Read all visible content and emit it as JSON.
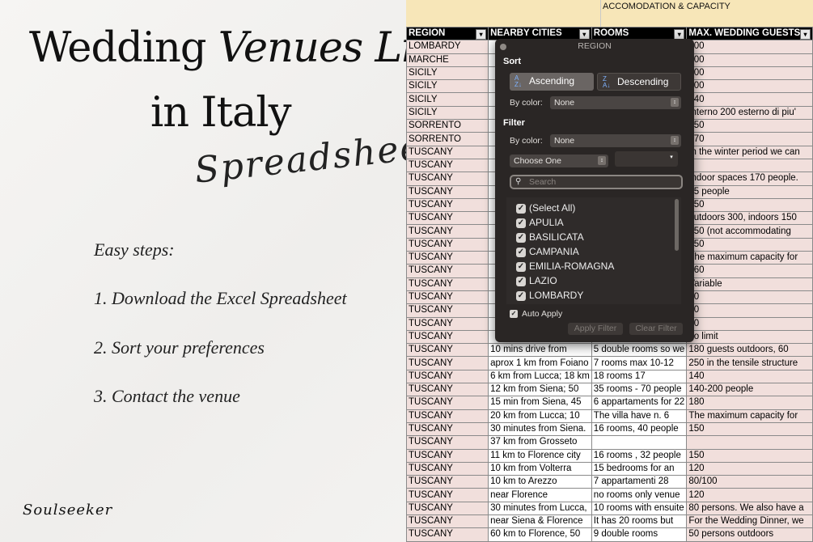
{
  "left": {
    "title_line1_a": "Wedding ",
    "title_line1_b": "Venues List",
    "title_line2": "in Italy",
    "script_word": "Spreadsheet",
    "steps": [
      "Easy steps:",
      "1. Download the Excel Spreadsheet",
      "2. Sort your preferences",
      "3. Contact the venue"
    ],
    "logo": "Soulseeker"
  },
  "sheet": {
    "group_header": "ACCOMODATION & CAPACITY",
    "columns": [
      "REGION",
      "NEARBY CITIES",
      "ROOMS",
      "MAX. WEDDING GUESTS"
    ],
    "rows": [
      [
        "LOMBARDY",
        "",
        "",
        "200"
      ],
      [
        "MARCHE",
        "",
        "",
        "100"
      ],
      [
        "SICILY",
        "",
        "",
        "300"
      ],
      [
        "SICILY",
        "",
        "",
        "300"
      ],
      [
        "SICILY",
        "",
        "",
        "240"
      ],
      [
        "SICILY",
        "",
        "",
        "Interno 200 esterno di piu'"
      ],
      [
        "SORRENTO",
        "",
        "",
        "250"
      ],
      [
        "SORRENTO",
        "",
        "",
        "270"
      ],
      [
        "TUSCANY",
        "",
        "",
        "In the winter period we can"
      ],
      [
        "TUSCANY",
        "",
        "",
        ""
      ],
      [
        "TUSCANY",
        "",
        "",
        "Indoor spaces 170 people."
      ],
      [
        "TUSCANY",
        "",
        "",
        "35 people"
      ],
      [
        "TUSCANY",
        "",
        "",
        "150"
      ],
      [
        "TUSCANY",
        "",
        "",
        "outdoors 300, indoors 150"
      ],
      [
        "TUSCANY",
        "",
        "",
        "150 (not accommodating"
      ],
      [
        "TUSCANY",
        "",
        "",
        "150"
      ],
      [
        "TUSCANY",
        "",
        "",
        "The maximum capacity for"
      ],
      [
        "TUSCANY",
        "",
        "",
        "160"
      ],
      [
        "TUSCANY",
        "",
        "",
        "Variable"
      ],
      [
        "TUSCANY",
        "",
        "",
        "90"
      ],
      [
        "TUSCANY",
        "",
        "",
        "50"
      ],
      [
        "TUSCANY",
        "",
        "",
        "50"
      ],
      [
        "TUSCANY",
        "",
        "",
        "no limit"
      ],
      [
        "TUSCANY",
        "10 mins drive from",
        "5 double rooms so we",
        "180 guests outdoors, 60"
      ],
      [
        "TUSCANY",
        "aprox 1 km from Foiano",
        "7 rooms max 10-12",
        "250 in the tensile structure"
      ],
      [
        "TUSCANY",
        "6 km from Lucca; 18 km",
        "18 rooms 17",
        "140"
      ],
      [
        "TUSCANY",
        "12 km from Siena; 50",
        "35 rooms - 70 people",
        "140-200 people"
      ],
      [
        "TUSCANY",
        "15 min from Siena, 45",
        "6 appartaments for 22",
        "180"
      ],
      [
        "TUSCANY",
        "20 km from Lucca; 10",
        "The villa have n. 6",
        "The maximum capacity for"
      ],
      [
        "TUSCANY",
        "30 minutes from Siena.",
        "16 rooms, 40 people",
        "150"
      ],
      [
        "TUSCANY",
        "37 km from Grosseto",
        "",
        ""
      ],
      [
        "TUSCANY",
        "11 km to Florence city",
        "16 rooms , 32 people",
        "150"
      ],
      [
        "TUSCANY",
        "10 km from Volterra",
        "15 bedrooms for an",
        "120"
      ],
      [
        "TUSCANY",
        "10 km to Arezzo",
        "7 appartamenti 28",
        "80/100"
      ],
      [
        "TUSCANY",
        "near Florence",
        "no rooms only venue",
        "120"
      ],
      [
        "TUSCANY",
        "30 minutes from Lucca,",
        "10 rooms with ensuite",
        "80 persons. We also have a"
      ],
      [
        "TUSCANY",
        "near Siena & Florence",
        "It has 20 rooms but",
        "For the Wedding Dinner, we"
      ],
      [
        "TUSCANY",
        "60 km to Florence, 50",
        "9 double rooms",
        "50 persons outdoors"
      ]
    ]
  },
  "popup": {
    "title": "REGION",
    "sort_label": "Sort",
    "ascending": "Ascending",
    "descending": "Descending",
    "by_color_label": "By color:",
    "sort_color_value": "None",
    "filter_label": "Filter",
    "filter_color_value": "None",
    "choose_one": "Choose One",
    "search_placeholder": "Search",
    "items": [
      "(Select All)",
      "APULIA",
      "BASILICATA",
      "CAMPANIA",
      "EMILIA-ROMAGNA",
      "LAZIO",
      "LOMBARDY"
    ],
    "auto_apply": "Auto Apply",
    "apply_filter": "Apply Filter",
    "clear_filter": "Clear Filter"
  }
}
